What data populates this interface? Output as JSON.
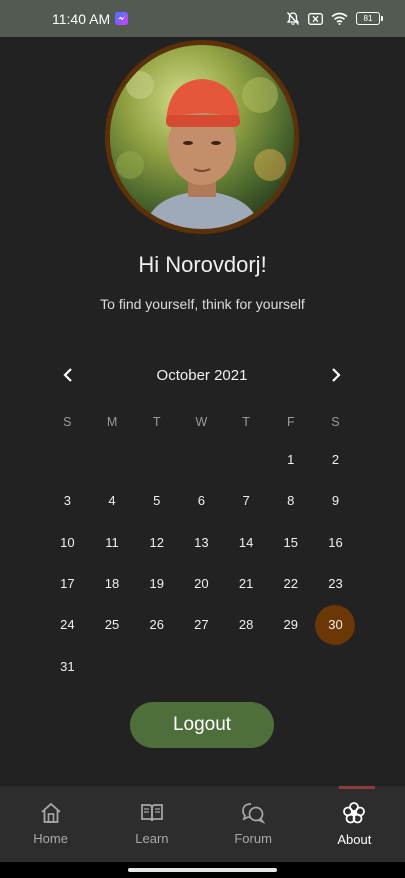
{
  "status_bar": {
    "time": "11:40 AM",
    "messenger_icon": "messenger-icon",
    "icons": [
      "bell-muted-icon",
      "no-sim-icon",
      "wifi-icon"
    ],
    "battery": "81"
  },
  "profile": {
    "avatar_icon": "profile-photo",
    "ring_color": "#5a3108",
    "greeting": "Hi Norovdorj!",
    "quote": "To find yourself, think for yourself"
  },
  "calendar": {
    "month_title": "October 2021",
    "prev_icon": "chevron-left-icon",
    "next_icon": "chevron-right-icon",
    "weekdays": [
      "S",
      "M",
      "T",
      "W",
      "T",
      "F",
      "S"
    ],
    "weeks": [
      [
        "",
        "",
        "",
        "",
        "",
        "1",
        "2"
      ],
      [
        "3",
        "4",
        "5",
        "6",
        "7",
        "8",
        "9"
      ],
      [
        "10",
        "11",
        "12",
        "13",
        "14",
        "15",
        "16"
      ],
      [
        "17",
        "18",
        "19",
        "20",
        "21",
        "22",
        "23"
      ],
      [
        "24",
        "25",
        "26",
        "27",
        "28",
        "29",
        "30"
      ],
      [
        "31",
        "",
        "",
        "",
        "",
        "",
        ""
      ]
    ],
    "selected_day": "30",
    "selected_color": "#6b3706"
  },
  "logout_label": "Logout",
  "logout_color": "#4e6e3b",
  "bottom_nav": {
    "items": [
      {
        "label": "Home",
        "icon": "home-icon"
      },
      {
        "label": "Learn",
        "icon": "book-icon"
      },
      {
        "label": "Forum",
        "icon": "chat-bubbles-icon"
      },
      {
        "label": "About",
        "icon": "flower-icon"
      }
    ],
    "active": "About",
    "indicator_color": "#8e3a3a"
  }
}
